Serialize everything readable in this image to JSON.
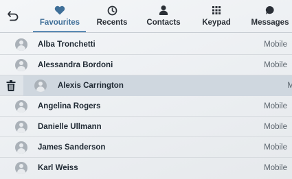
{
  "tabs": [
    {
      "label": "Favourites",
      "icon": "heart-icon",
      "active": true
    },
    {
      "label": "Recents",
      "icon": "clock-icon",
      "active": false
    },
    {
      "label": "Contacts",
      "icon": "person-icon",
      "active": false
    },
    {
      "label": "Keypad",
      "icon": "keypad-icon",
      "active": false
    },
    {
      "label": "Messages",
      "icon": "chat-bubble-icon",
      "active": false
    }
  ],
  "contacts": [
    {
      "name": "Alba Tronchetti",
      "type": "Mobile"
    },
    {
      "name": "Alessandra Bordoni",
      "type": "Mobile"
    },
    {
      "name": "Alexis Carrington",
      "type": "M",
      "swiped": true
    },
    {
      "name": "Angelina Rogers",
      "type": "Mobile"
    },
    {
      "name": "Danielle Ullmann",
      "type": "Mobile"
    },
    {
      "name": "James Sanderson",
      "type": "Mobile"
    },
    {
      "name": "Karl Weiss",
      "type": "Mobile"
    }
  ],
  "colors": {
    "accent": "#3f6f98",
    "underline": "#5b8bb4",
    "avatar": "#aab1b8"
  }
}
